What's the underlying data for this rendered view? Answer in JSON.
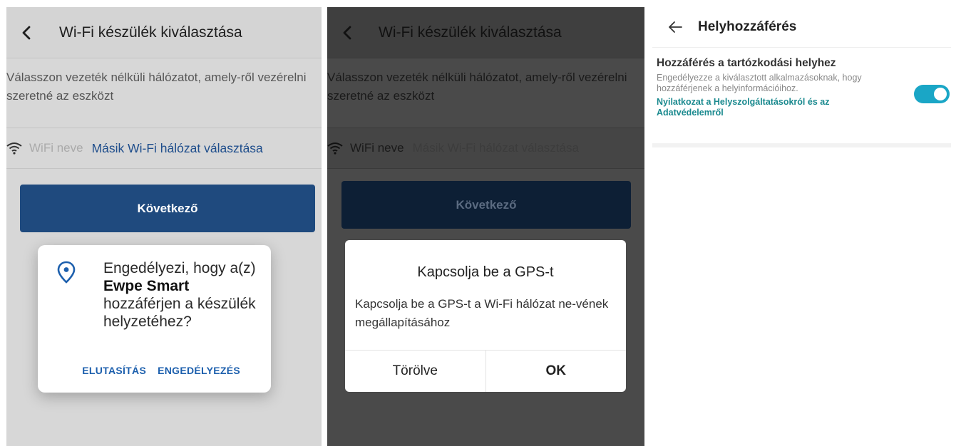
{
  "panel1": {
    "header_title": "Wi-Fi készülék kiválasztása",
    "description": "Válasszon vezeték nélküli hálózatot, amely-ről vezérelni szeretné az eszközt",
    "wifi_placeholder": "WiFi neve",
    "other_network": "Másik Wi-Fi hálózat választása",
    "next_button": "Következő",
    "permission_dialog": {
      "text_prefix": "Engedélyezi, hogy a(z)",
      "app_name": "Ewpe Smart",
      "text_suffix": "hozzáférjen a készülék helyzetéhez?",
      "deny_label": "ELUTASÍTÁS",
      "allow_label": "ENGEDÉLYEZÉS"
    }
  },
  "panel2": {
    "header_title": "Wi-Fi készülék kiválasztása",
    "description": "Válasszon vezeték nélküli hálózatot, amely-ről vezérelni szeretné az eszközt",
    "wifi_placeholder": "WiFi neve",
    "other_network": "Másik Wi-Fi hálózat választása",
    "next_button": "Következő",
    "gps_dialog": {
      "title": "Kapcsolja be a GPS-t",
      "message": "Kapcsolja be a GPS-t a Wi-Fi hálózat ne-vének megállapításához",
      "cancel_label": "Törölve",
      "ok_label": "OK"
    }
  },
  "panel3": {
    "header_title": "Helyhozzáférés",
    "section_title": "Hozzáférés a tartózkodási helyhez",
    "section_desc": "Engedélyezze a kiválasztott alkalmazásoknak, hogy hozzáférjenek a helyinformációihoz.",
    "section_link": "Nyilatkozat a Helyszolgáltatásokról és az Adatvédelemről",
    "toggle_on": true
  },
  "colors": {
    "primary_blue": "#1f4a7e",
    "link_blue": "#1c5fad",
    "teal_link": "#1b8a8f",
    "toggle_on": "#1aa6c6"
  },
  "icons": [
    "chevron-left-icon",
    "wifi-icon",
    "location-pin-icon",
    "arrow-left-icon"
  ]
}
